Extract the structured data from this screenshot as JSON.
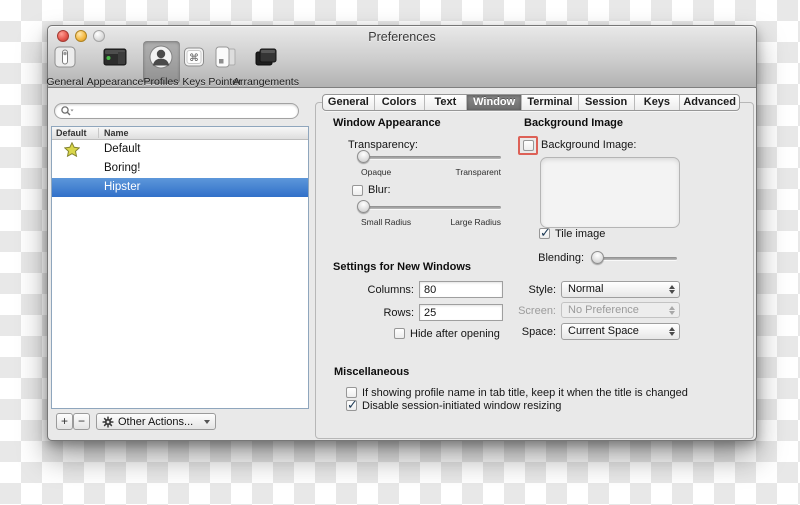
{
  "window": {
    "title": "Preferences"
  },
  "toolbar": {
    "items": [
      {
        "label": "General"
      },
      {
        "label": "Appearance"
      },
      {
        "label": "Profiles"
      },
      {
        "label": "Keys"
      },
      {
        "label": "Pointer"
      },
      {
        "label": "Arrangements"
      }
    ],
    "selected": "Profiles"
  },
  "sidebar": {
    "search": {
      "placeholder": ""
    },
    "profile_table": {
      "columns": [
        "Default",
        "Name"
      ],
      "rows": [
        {
          "is_default": true,
          "name": "Default",
          "selected": false
        },
        {
          "is_default": false,
          "name": "Boring!",
          "selected": false
        },
        {
          "is_default": false,
          "name": "Hipster",
          "selected": true
        }
      ]
    },
    "add_button": "+",
    "remove_button": "−",
    "other_actions_button": "Other Actions..."
  },
  "tab_bar": {
    "tabs": [
      "General",
      "Colors",
      "Text",
      "Window",
      "Terminal",
      "Session",
      "Keys",
      "Advanced"
    ],
    "selected": "Window"
  },
  "window_appearance": {
    "heading": "Window Appearance",
    "transparency_label": "Transparency:",
    "transparency_min": "Opaque",
    "transparency_max": "Transparent",
    "transparency_value_pct": 0,
    "blur_label": "Blur:",
    "blur_checked": false,
    "blur_min": "Small Radius",
    "blur_max": "Large Radius",
    "blur_value_pct": 0
  },
  "new_windows": {
    "heading": "Settings for New Windows",
    "columns_label": "Columns:",
    "columns_value": "80",
    "rows_label": "Rows:",
    "rows_value": "25",
    "hide_label": "Hide after opening",
    "hide_checked": false
  },
  "background_image": {
    "heading": "Background Image",
    "checkbox_label": "Background Image:",
    "checkbox_checked": false,
    "checkbox_highlighted": true,
    "tile_label": "Tile image",
    "tile_checked": true,
    "blending_label": "Blending:",
    "blending_value_pct": 0,
    "style_label": "Style:",
    "style_value": "Normal",
    "screen_label": "Screen:",
    "screen_value": "No Preference",
    "screen_disabled": true,
    "space_label": "Space:",
    "space_value": "Current Space"
  },
  "misc": {
    "heading": "Miscellaneous",
    "item1_label": "If showing profile name in tab title, keep it when the title is changed",
    "item1_checked": false,
    "item2_label": "Disable session-initiated window resizing",
    "item2_checked": true
  },
  "icons": {
    "command": "⌘",
    "check": "✓"
  },
  "colors": {
    "selection_blue": "#3b77cf",
    "highlight_red": "#dd6157",
    "default_star_yellow": "#d9d64a"
  }
}
